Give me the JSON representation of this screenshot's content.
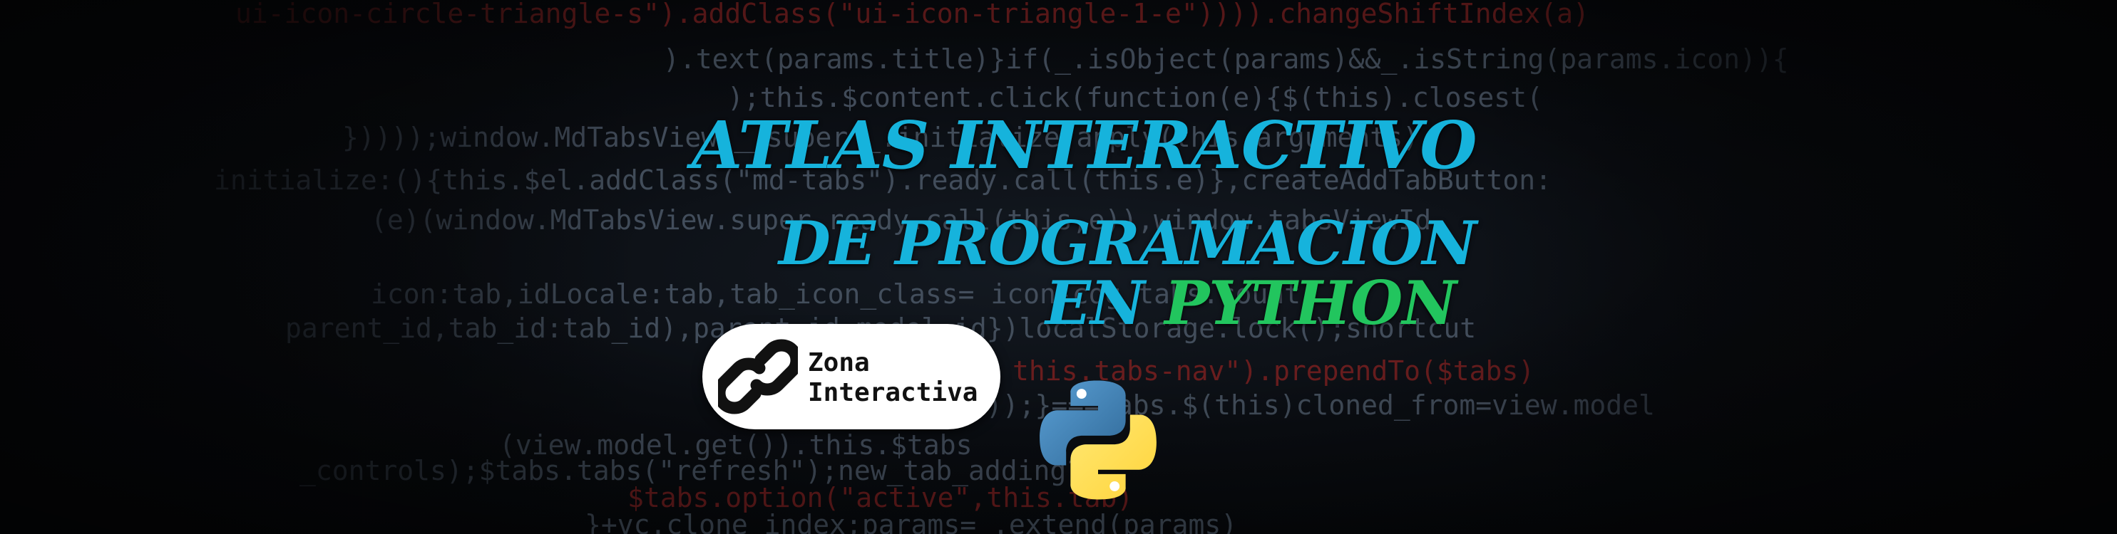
{
  "title": {
    "line1": "ATLAS INTERACTIVO",
    "line2": "DE PROGRAMACION",
    "line3_prefix": "EN",
    "line3_highlight": "PYTHON"
  },
  "badge": {
    "line1": "Zona",
    "line2": "Interactiva",
    "icon": "link-icon"
  },
  "logo": {
    "icon": "python-logo-icon"
  },
  "background_code": [
    "ui-icon-circle-triangle-s\").addClass(\"ui-icon-triangle-1-e\")))).changeShiftIndex(a)",
    ").text(params.title)}if(_.isObject(params)&&_.isString(params.icon)){",
    ");this.$content.click(function(e){$(this).closest(",
    "}))));window.MdTabsView.__super__.initialize.apply(this,arguments)",
    "initialize:(){this.$el.addClass(\"md-tabs\").ready.call(this.e)},createAddTabButton:",
    "(e)(window.MdTabsView.super.ready.call(this,e)),window.tabsViewId",
    "icon:tab,idLocale:tab,tab_icon_class= icon-cog tabs.count",
    "parent_id,tab_id:tab_id),parent_id.model.id})localStorage.lock();shortcut",
    "this.tabs-nav\").prependTo($tabs)",
    "}));}===tabs.$(this)cloned_from=view.model",
    "(view.model.get()).this.$tabs",
    "_controls);$tabs.tabs(\"refresh\");new_tab_adding?",
    "$tabs.option(\"active\",this.tab)",
    "}+vc.clone_index;params=_.extend(params)"
  ],
  "colors": {
    "title_cyan": "#16b3dc",
    "python_green": "#22c55e",
    "badge_bg": "#ffffff",
    "badge_text": "#111111",
    "background": "#050608"
  }
}
